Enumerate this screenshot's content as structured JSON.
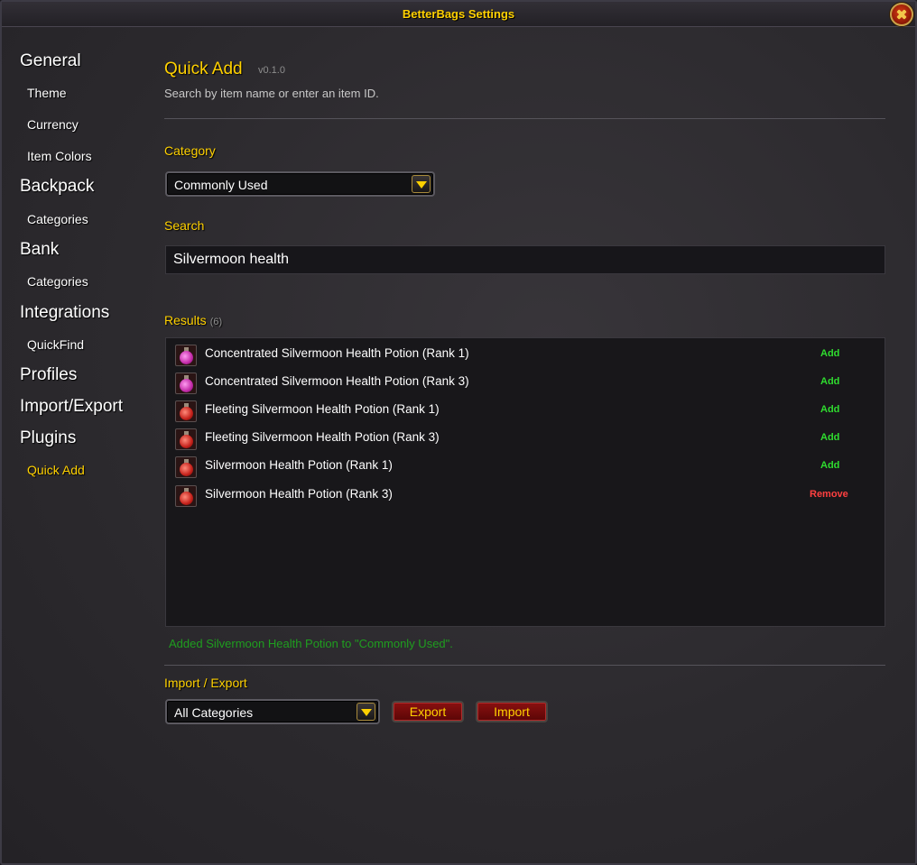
{
  "window": {
    "title": "BetterBags Settings"
  },
  "sidebar": {
    "general": "General",
    "theme": "Theme",
    "currency": "Currency",
    "item_colors": "Item Colors",
    "backpack": "Backpack",
    "backpack_categories": "Categories",
    "bank": "Bank",
    "bank_categories": "Categories",
    "integrations": "Integrations",
    "quickfind": "QuickFind",
    "profiles": "Profiles",
    "import_export": "Import/Export",
    "plugins": "Plugins",
    "quick_add": "Quick Add"
  },
  "main": {
    "heading": "Quick Add",
    "version": "v0.1.0",
    "subtitle": "Search by item name or enter an item ID.",
    "category_label": "Category",
    "category_value": "Commonly Used",
    "search_label": "Search",
    "search_value": "Silvermoon health",
    "results_label": "Results",
    "results_count": "(6)",
    "results": [
      {
        "name": "Concentrated Silvermoon Health Potion (Rank 1)",
        "action": "Add",
        "icon": "pink-potion-icon"
      },
      {
        "name": "Concentrated Silvermoon Health Potion (Rank 3)",
        "action": "Add",
        "icon": "pink-potion-icon"
      },
      {
        "name": "Fleeting Silvermoon Health Potion (Rank 1)",
        "action": "Add",
        "icon": "red-potion-icon"
      },
      {
        "name": "Fleeting Silvermoon Health Potion (Rank 3)",
        "action": "Add",
        "icon": "red-potion-icon"
      },
      {
        "name": "Silvermoon Health Potion (Rank 1)",
        "action": "Add",
        "icon": "red-potion-icon"
      },
      {
        "name": "Silvermoon Health Potion (Rank 3)",
        "action": "Remove",
        "icon": "red-potion-icon"
      }
    ],
    "status_message": "Added Silvermoon Health Potion to \"Commonly Used\".",
    "import_export_label": "Import / Export",
    "import_export_value": "All Categories",
    "export_button": "Export",
    "import_button": "Import"
  },
  "colors": {
    "accent": "#ffd100",
    "add": "#2fdd2f",
    "remove": "#ff4040",
    "status": "#1f9e1f"
  }
}
